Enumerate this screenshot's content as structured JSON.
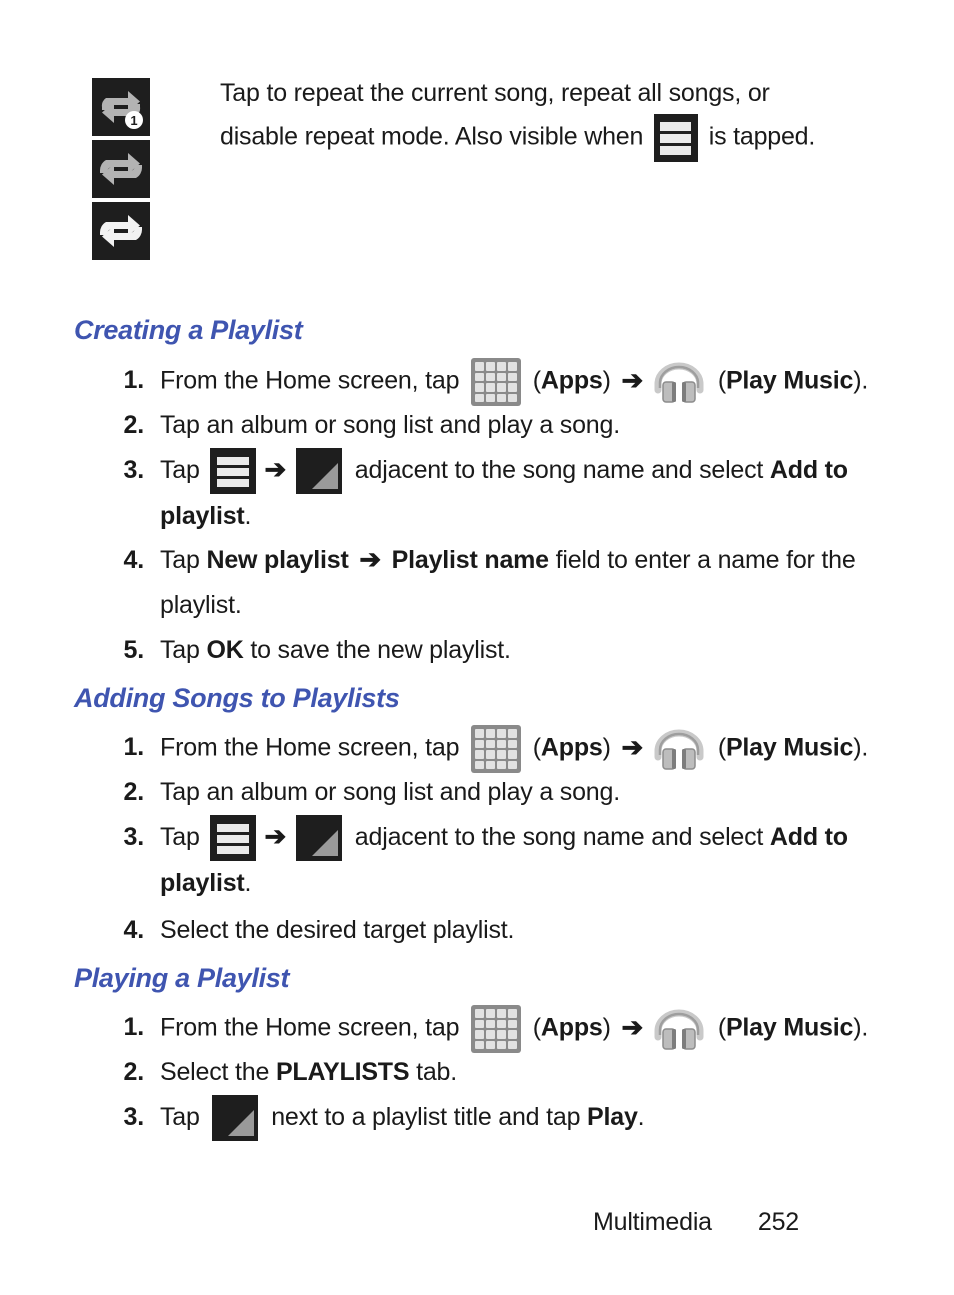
{
  "page": {
    "background": "#ffffff",
    "accent_color": "#3f55b0",
    "text_color": "#1a1a1a"
  },
  "note": {
    "icons": [
      {
        "name": "repeat-one-icon",
        "label": "repeat one"
      },
      {
        "name": "repeat-all-icon-gray",
        "label": "repeat all (gray)"
      },
      {
        "name": "repeat-all-icon-white",
        "label": "repeat all (white)"
      }
    ],
    "line1": "Tap to repeat the current song, repeat all songs, or",
    "line2_a": "disable repeat mode. Also visible when",
    "line2_icon": "menu-icon",
    "line2_b": "is tapped."
  },
  "sections": [
    {
      "heading": "Creating a Playlist",
      "steps": [
        {
          "num": "1.",
          "parts": [
            {
              "t": "From the Home screen, tap "
            },
            {
              "icon": "apps-grid-icon"
            },
            {
              "t": " ("
            },
            {
              "b": "Apps"
            },
            {
              "t": ") "
            },
            {
              "arrow": "➔"
            },
            {
              "t": " "
            },
            {
              "icon": "headphones-icon"
            },
            {
              "t": " ("
            },
            {
              "b": "Play Music"
            },
            {
              "t": ")."
            }
          ]
        },
        {
          "num": "2.",
          "parts": [
            {
              "t": "Tap an album or song list and play a song."
            }
          ]
        },
        {
          "num": "3.",
          "parts": [
            {
              "t": "Tap "
            },
            {
              "icon": "menu-icon"
            },
            {
              "t": " "
            },
            {
              "arrow": "➔"
            },
            {
              "t": " "
            },
            {
              "icon": "corner-triangle-icon"
            },
            {
              "t": " adjacent to the song name and select "
            },
            {
              "b": "Add to playlist"
            },
            {
              "t": "."
            }
          ]
        },
        {
          "num": "4.",
          "parts": [
            {
              "t": "Tap "
            },
            {
              "b": "New playlist"
            },
            {
              "t": " "
            },
            {
              "arrow": "➔"
            },
            {
              "t": " "
            },
            {
              "b": "Playlist name"
            },
            {
              "t": " field to enter a name for the playlist."
            }
          ]
        },
        {
          "num": "5.",
          "parts": [
            {
              "t": "Tap "
            },
            {
              "b": "OK"
            },
            {
              "t": " to save the new playlist."
            }
          ]
        }
      ]
    },
    {
      "heading": "Adding Songs to Playlists",
      "steps": [
        {
          "num": "1.",
          "parts": [
            {
              "t": "From the Home screen, tap "
            },
            {
              "icon": "apps-grid-icon"
            },
            {
              "t": " ("
            },
            {
              "b": "Apps"
            },
            {
              "t": ") "
            },
            {
              "arrow": "➔"
            },
            {
              "t": " "
            },
            {
              "icon": "headphones-icon"
            },
            {
              "t": " ("
            },
            {
              "b": "Play Music"
            },
            {
              "t": ")."
            }
          ]
        },
        {
          "num": "2.",
          "parts": [
            {
              "t": "Tap an album or song list and play a song."
            }
          ]
        },
        {
          "num": "3.",
          "parts": [
            {
              "t": "Tap "
            },
            {
              "icon": "menu-icon"
            },
            {
              "t": " "
            },
            {
              "arrow": "➔"
            },
            {
              "t": " "
            },
            {
              "icon": "corner-triangle-icon"
            },
            {
              "t": " adjacent to the song name and select "
            },
            {
              "b": "Add to playlist"
            },
            {
              "t": "."
            }
          ]
        },
        {
          "num": "4.",
          "parts": [
            {
              "t": "Select the desired target playlist."
            }
          ]
        }
      ]
    },
    {
      "heading": "Playing a Playlist",
      "steps": [
        {
          "num": "1.",
          "parts": [
            {
              "t": "From the Home screen, tap "
            },
            {
              "icon": "apps-grid-icon"
            },
            {
              "t": " ("
            },
            {
              "b": "Apps"
            },
            {
              "t": ") "
            },
            {
              "arrow": "➔"
            },
            {
              "t": " "
            },
            {
              "icon": "headphones-icon"
            },
            {
              "t": " ("
            },
            {
              "b": "Play Music"
            },
            {
              "t": ")."
            }
          ]
        },
        {
          "num": "2.",
          "parts": [
            {
              "t": "Select the "
            },
            {
              "b": "PLAYLISTS"
            },
            {
              "t": " tab."
            }
          ]
        },
        {
          "num": "3.",
          "parts": [
            {
              "t": "Tap "
            },
            {
              "icon": "corner-triangle-icon"
            },
            {
              "t": " next to a playlist title and tap "
            },
            {
              "b": "Play"
            },
            {
              "t": "."
            }
          ]
        }
      ]
    }
  ],
  "footer": {
    "chapter": "Multimedia",
    "page_number": "252"
  }
}
